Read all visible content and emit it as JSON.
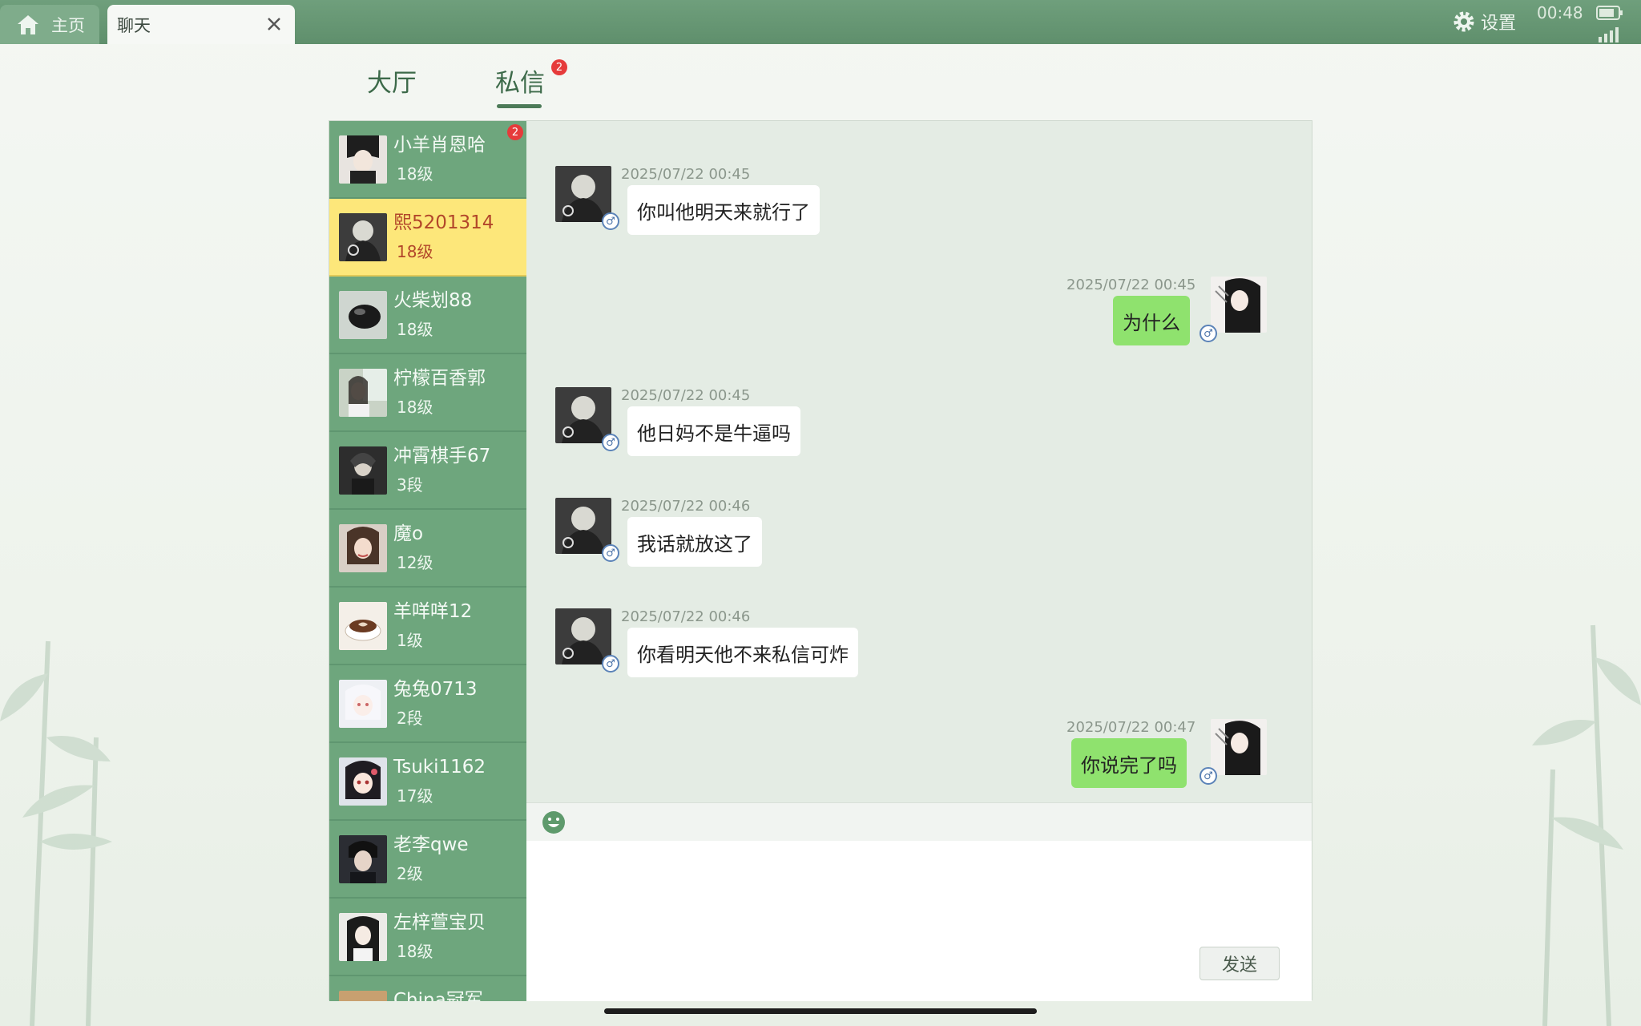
{
  "top_bar": {
    "home_tab": "主页",
    "chat_tab": "聊天",
    "settings": "设置",
    "time": "00:48"
  },
  "tabs": {
    "hall": "大厅",
    "private": "私信",
    "private_badge": "2"
  },
  "contacts": [
    {
      "name": "小羊肖恩哈",
      "level": "18级",
      "badge": "2",
      "active": false,
      "avatar": "dark-hair-portrait"
    },
    {
      "name": "熙5201314",
      "level": "18级",
      "active": true,
      "avatar": "masked-figure"
    },
    {
      "name": "火柴划88",
      "level": "18级",
      "active": false,
      "avatar": "black-orb"
    },
    {
      "name": "柠檬百香郭",
      "level": "18级",
      "active": false,
      "avatar": "window-girl"
    },
    {
      "name": "冲霄棋手67",
      "level": "3段",
      "active": false,
      "avatar": "hooded-figure"
    },
    {
      "name": "魔o",
      "level": "12级",
      "active": false,
      "avatar": "girl-portrait"
    },
    {
      "name": "羊咩咩12",
      "level": "1级",
      "active": false,
      "avatar": "coffee-cup"
    },
    {
      "name": "兔兔0713",
      "level": "2段",
      "active": false,
      "avatar": "anime-girl-white"
    },
    {
      "name": "Tsuki1162",
      "level": "17级",
      "active": false,
      "avatar": "anime-girl-dark"
    },
    {
      "name": "老李qwe",
      "level": "2级",
      "active": false,
      "avatar": "dark-boy"
    },
    {
      "name": "左梓萱宝贝",
      "level": "18级",
      "active": false,
      "avatar": "long-hair-girl"
    },
    {
      "name": "China冠军",
      "level": "",
      "active": false,
      "avatar": "partial"
    }
  ],
  "messages": [
    {
      "time": "2025/07/22 00:45",
      "text": "你叫他明天来就行了",
      "side": "in"
    },
    {
      "time": "2025/07/22 00:45",
      "text": "为什么",
      "side": "out"
    },
    {
      "time": "2025/07/22 00:45",
      "text": "他日妈不是牛逼吗",
      "side": "in"
    },
    {
      "time": "2025/07/22 00:46",
      "text": "我话就放这了",
      "side": "in"
    },
    {
      "time": "2025/07/22 00:46",
      "text": "你看明天他不来私信可炸",
      "side": "in"
    },
    {
      "time": "2025/07/22 00:47",
      "text": "你说完了吗",
      "side": "out"
    }
  ],
  "send_label": "发送",
  "colors": {
    "top_bar": "#5f8f6c",
    "contact_list": "#6ea67d",
    "active_contact": "#fde77a",
    "outgoing_bubble": "#8fe26e",
    "badge": "#e63b3b"
  }
}
